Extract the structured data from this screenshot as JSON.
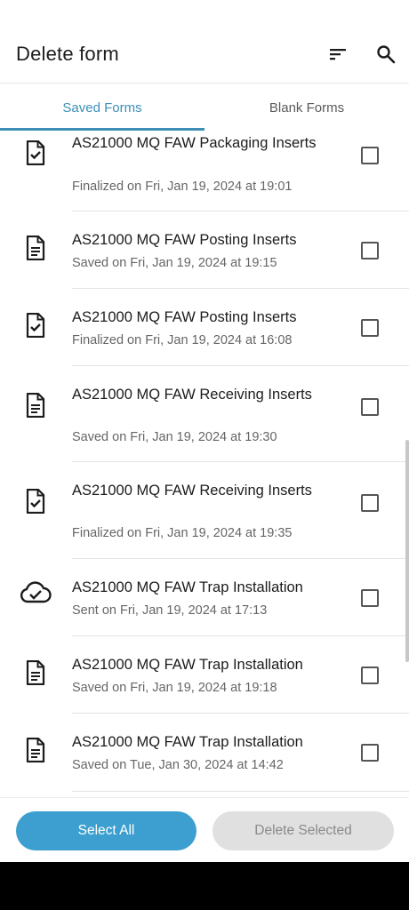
{
  "header": {
    "title": "Delete form",
    "sort_icon": "sort-icon",
    "search_icon": "search-icon"
  },
  "tabs": [
    {
      "label": "Saved Forms",
      "selected": true
    },
    {
      "label": "Blank Forms",
      "selected": false
    }
  ],
  "colors": {
    "accent": "#3d8fb8",
    "primary_button": "#3d9fcf",
    "disabled_button": "#e0e0e0"
  },
  "forms": [
    {
      "title": "AS21000 MQ FAW Packaging Inserts",
      "subtitle": "Finalized on Fri, Jan 19, 2024 at 19:01",
      "icon": "finalized-form-icon"
    },
    {
      "title": "AS21000 MQ FAW Posting Inserts",
      "subtitle": "Saved on Fri, Jan 19, 2024 at 19:15",
      "icon": "saved-form-icon"
    },
    {
      "title": "AS21000 MQ FAW Posting Inserts",
      "subtitle": "Finalized on Fri, Jan 19, 2024 at 16:08",
      "icon": "finalized-form-icon"
    },
    {
      "title": "AS21000 MQ FAW Receiving Inserts",
      "subtitle": "Saved on Fri, Jan 19, 2024 at 19:30",
      "icon": "saved-form-icon"
    },
    {
      "title": "AS21000 MQ FAW Receiving Inserts",
      "subtitle": "Finalized on Fri, Jan 19, 2024 at 19:35",
      "icon": "finalized-form-icon"
    },
    {
      "title": "AS21000 MQ FAW Trap Installation",
      "subtitle": "Sent on Fri, Jan 19, 2024 at 17:13",
      "icon": "sent-cloud-icon"
    },
    {
      "title": "AS21000 MQ FAW Trap Installation",
      "subtitle": "Saved on Fri, Jan 19, 2024 at 19:18",
      "icon": "saved-form-icon"
    },
    {
      "title": "AS21000 MQ FAW Trap Installation",
      "subtitle": "Saved on Tue, Jan 30, 2024 at 14:42",
      "icon": "saved-form-icon"
    }
  ],
  "actions": {
    "select_all_label": "Select All",
    "delete_selected_label": "Delete Selected"
  }
}
